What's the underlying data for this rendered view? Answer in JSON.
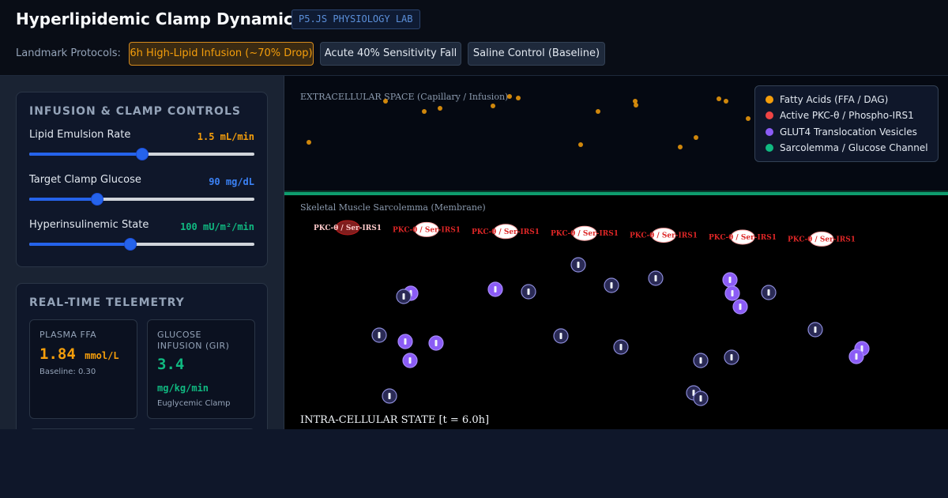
{
  "header": {
    "title": "Hyperlipidemic Clamp Dynamics",
    "badge": "P5.JS PHYSIOLOGY LAB",
    "protocols_label": "Landmark Protocols:",
    "protocols": [
      {
        "label": "6h High-Lipid Infusion (~70% Drop)",
        "active": true
      },
      {
        "label": "Acute 40% Sensitivity Fall",
        "active": false
      },
      {
        "label": "Saline Control (Baseline)",
        "active": false
      }
    ]
  },
  "controls": {
    "title": "INFUSION & CLAMP CONTROLS",
    "sliders": [
      {
        "label": "Lipid Emulsion Rate",
        "value": "1.5 mL/min",
        "color": "#f59e0b",
        "fraction": 0.5
      },
      {
        "label": "Target Clamp Glucose",
        "value": "90 mg/dL",
        "color": "#3b82f6",
        "fraction": 0.3
      },
      {
        "label": "Hyperinsulinemic State",
        "value": "100 mU/m²/min",
        "color": "#10b981",
        "fraction": 0.45
      }
    ]
  },
  "telemetry": {
    "title": "REAL-TIME TELEMETRY",
    "cards": [
      {
        "label": "PLASMA FFA",
        "value": "1.84",
        "unit": "mmol/L",
        "sub": "Baseline: 0.30",
        "color": "#f59e0b"
      },
      {
        "label": "GLUCOSE INFUSION (GIR)",
        "value": "3.4",
        "unit": "mg/kg/min",
        "sub": "Euglycemic Clamp",
        "color": "#10b981"
      }
    ]
  },
  "visualization": {
    "extracellular_label": "EXTRACELLULAR SPACE (Capillary / Infusion)",
    "membrane_label": "Skeletal Muscle Sarcolemma (Membrane)",
    "intracellular_label": "INTRA-CELLULAR STATE [t = 6.0h]",
    "complex_label": "PKC-θ / Ser-IRS1",
    "complex_count": 7,
    "colors": {
      "fatty_acid": "#f59e0b",
      "pkc": "#ef4444",
      "glut4": "#8b5cf6",
      "membrane": "#10b981"
    }
  },
  "legend": [
    {
      "label": "Fatty Acids (FFA / DAG)",
      "color": "#f59e0b"
    },
    {
      "label": "Active PKC-θ / Phospho-IRS1",
      "color": "#ef4444"
    },
    {
      "label": "GLUT4 Translocation Vesicles",
      "color": "#8b5cf6"
    },
    {
      "label": "Sarcolemma / Glucose Channel",
      "color": "#10b981"
    }
  ]
}
